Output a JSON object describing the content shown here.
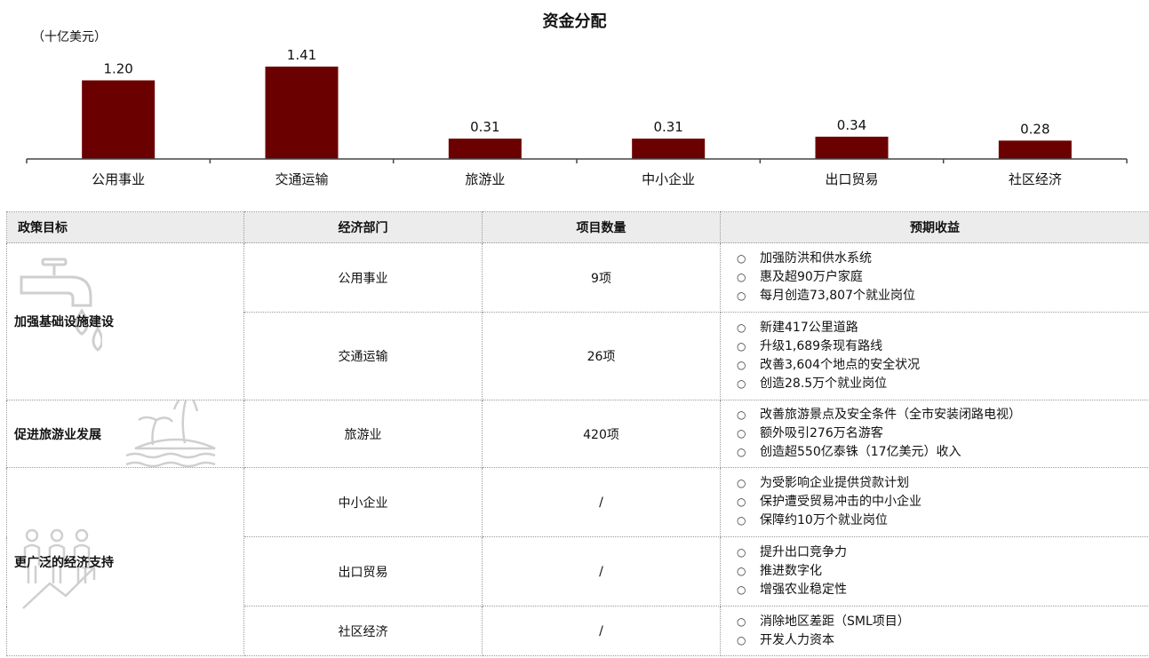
{
  "chart_data": {
    "type": "bar",
    "title": "资金分配",
    "unit_label": "（十亿美元）",
    "categories": [
      "公用事业",
      "交通运输",
      "旅游业",
      "中小企业",
      "出口贸易",
      "社区经济"
    ],
    "values": [
      1.2,
      1.41,
      0.31,
      0.31,
      0.34,
      0.28
    ],
    "value_labels": [
      "1.20",
      "1.41",
      "0.31",
      "0.31",
      "0.34",
      "0.28"
    ],
    "ylim": [
      0,
      1.41
    ],
    "bar_color": "#6b0000"
  },
  "table": {
    "headers": [
      "政策目标",
      "经济部门",
      "项目数量",
      "预期收益"
    ],
    "goals": [
      "加强基础设施建设",
      "促进旅游业发展",
      "更广泛的经济支持"
    ],
    "rows": [
      {
        "sector": "公用事业",
        "count": "9项",
        "benefits": [
          "加强防洪和供水系统",
          "惠及超90万户家庭",
          "每月创造73,807个就业岗位"
        ]
      },
      {
        "sector": "交通运输",
        "count": "26项",
        "benefits": [
          "新建417公里道路",
          "升级1,689条现有路线",
          "改善3,604个地点的安全状况",
          "创造28.5万个就业岗位"
        ]
      },
      {
        "sector": "旅游业",
        "count": "420项",
        "benefits": [
          "改善旅游景点及安全条件（全市安装闭路电视）",
          "额外吸引276万名游客",
          "创造超550亿泰铢（17亿美元）收入"
        ]
      },
      {
        "sector": "中小企业",
        "count": "/",
        "benefits": [
          "为受影响企业提供贷款计划",
          "保护遭受贸易冲击的中小企业",
          "保障约10万个就业岗位"
        ]
      },
      {
        "sector": "出口贸易",
        "count": "/",
        "benefits": [
          "提升出口竞争力",
          "推进数字化",
          "增强农业稳定性"
        ]
      },
      {
        "sector": "社区经济",
        "count": "/",
        "benefits": [
          "消除地区差距（SML项目）",
          "开发人力资本"
        ]
      }
    ],
    "icons": [
      "water-tap-icon",
      "palm-island-icon",
      "people-growth-icon"
    ],
    "icon_color": "#cfcfcf"
  }
}
